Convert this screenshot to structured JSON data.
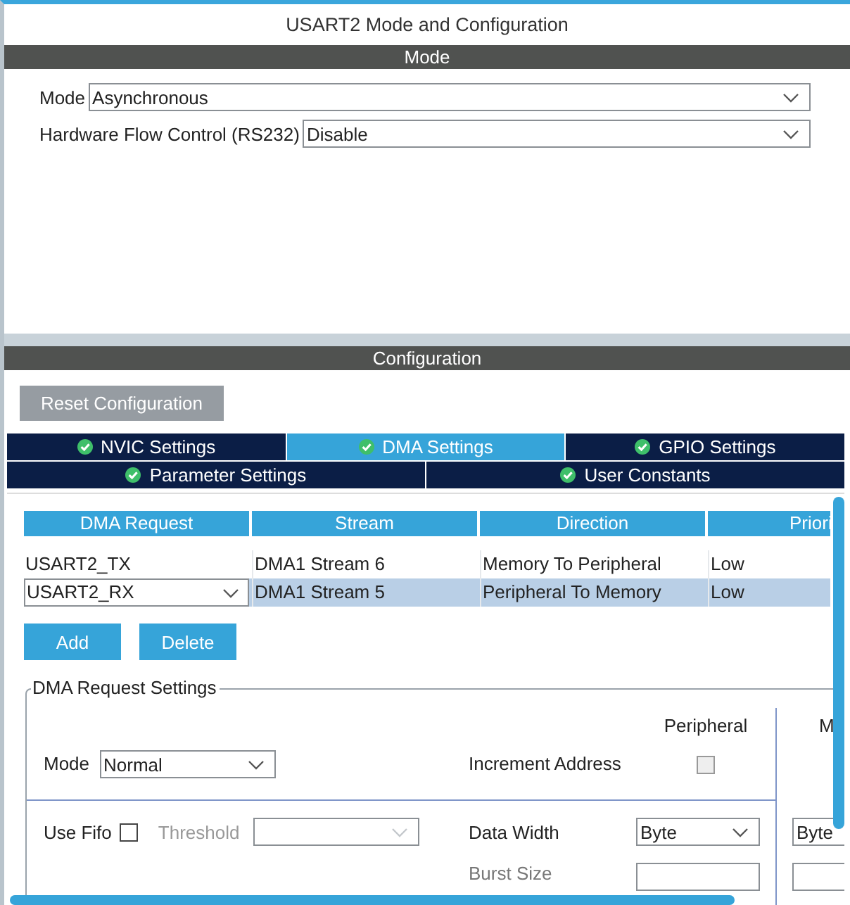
{
  "window": {
    "title": "USART2 Mode and Configuration"
  },
  "mode_section": {
    "title": "Mode",
    "fields": [
      {
        "label": "Mode",
        "value": "Asynchronous"
      },
      {
        "label": "Hardware Flow Control (RS232)",
        "value": "Disable"
      }
    ]
  },
  "configuration": {
    "title": "Configuration",
    "reset_button": "Reset Configuration",
    "tab_rows": [
      [
        {
          "label": "NVIC Settings",
          "selected": false
        },
        {
          "label": "DMA Settings",
          "selected": true
        },
        {
          "label": "GPIO Settings",
          "selected": false
        }
      ],
      [
        {
          "label": "Parameter Settings",
          "selected": false
        },
        {
          "label": "User Constants",
          "selected": false
        }
      ]
    ]
  },
  "dma_table": {
    "columns": [
      "DMA Request",
      "Stream",
      "Direction",
      "Priori"
    ],
    "rows": [
      {
        "cells": [
          "USART2_TX",
          "DMA1 Stream 6",
          "Memory To Peripheral",
          "Low"
        ],
        "selected": false
      },
      {
        "cells": [
          "USART2_RX",
          "DMA1 Stream 5",
          "Peripheral To Memory",
          "Low"
        ],
        "selected": true
      }
    ]
  },
  "buttons": [
    "Add",
    "Delete"
  ],
  "request_settings": {
    "title": "DMA Request Settings",
    "peripheral_header": "Peripheral",
    "memory_header": "M",
    "mode": {
      "label": "Mode",
      "value": "Normal"
    },
    "increment_address": {
      "label": "Increment Address",
      "peripheral_checked": false
    },
    "use_fifo": {
      "label": "Use Fifo",
      "checked": false
    },
    "threshold": {
      "label": "Threshold",
      "disabled": true
    },
    "data_width": {
      "label": "Data Width",
      "peripheral": "Byte",
      "memory": "Byte"
    },
    "burst_size": {
      "label": "Burst Size"
    }
  }
}
